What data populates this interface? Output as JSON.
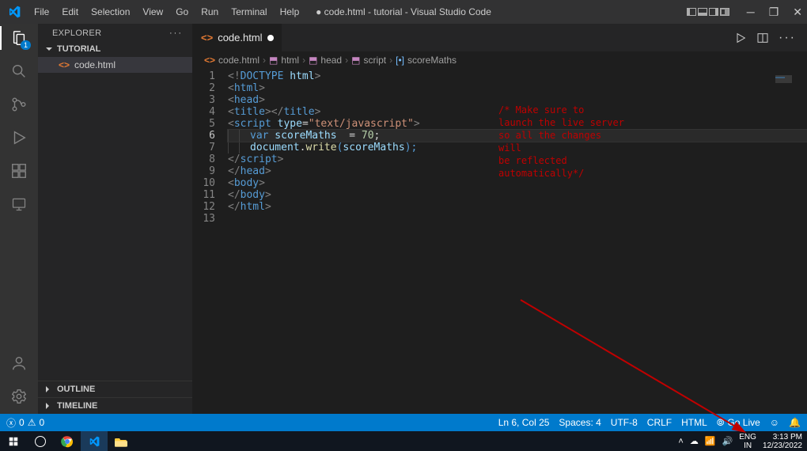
{
  "window": {
    "title": "● code.html - tutorial - Visual Studio Code"
  },
  "menu": [
    "File",
    "Edit",
    "Selection",
    "View",
    "Go",
    "Run",
    "Terminal",
    "Help"
  ],
  "activity": {
    "explorer_badge": "1"
  },
  "sidebar": {
    "title": "EXPLORER",
    "folder": "TUTORIAL",
    "file": "code.html",
    "outline": "OUTLINE",
    "timeline": "TIMELINE"
  },
  "tab": {
    "label": "code.html"
  },
  "breadcrumb": {
    "a": "code.html",
    "b": "html",
    "c": "head",
    "d": "script",
    "e": "scoreMaths"
  },
  "gutter": [
    "1",
    "2",
    "3",
    "4",
    "5",
    "6",
    "7",
    "8",
    "9",
    "10",
    "11",
    "12",
    "13"
  ],
  "code": {
    "l1_a": "<!",
    "l1_b": "DOCTYPE",
    "l1_c": " html",
    "l1_d": ">",
    "l2_a": "<",
    "l2_b": "html",
    "l2_c": ">",
    "l3_a": "<",
    "l3_b": "head",
    "l3_c": ">",
    "l4_a": "<",
    "l4_b": "title",
    "l4_c": "></",
    "l4_d": "title",
    "l4_e": ">",
    "l5_a": "<",
    "l5_b": "script",
    "l5_c": " type",
    "l5_d": "=",
    "l5_e": "\"text/javascript\"",
    "l5_f": ">",
    "l6_a": "var",
    "l6_b": " scoreMaths  ",
    "l6_c": "=",
    "l6_d": " 70",
    "l6_e": ";",
    "l7_a": "document",
    "l7_b": ".",
    "l7_c": "write",
    "l7_d": "(",
    "l7_e": "scoreMaths",
    "l7_f": ");",
    "l8_a": "</",
    "l8_b": "script",
    "l8_c": ">",
    "l9_a": "</",
    "l9_b": "head",
    "l9_c": ">",
    "l10_a": "<",
    "l10_b": "body",
    "l10_c": ">",
    "l11_a": "</",
    "l11_b": "body",
    "l11_c": ">",
    "l12_a": "</",
    "l12_b": "html",
    "l12_c": ">"
  },
  "annotation": {
    "l1": "/* Make sure to",
    "l2": "launch the live server",
    "l3": "so all the changes will",
    "l4": "be reflected",
    "l5": "automatically*/"
  },
  "statusbar": {
    "errors": "0",
    "warnings": "0",
    "lncol": "Ln 6, Col 25",
    "spaces": "Spaces: 4",
    "encoding": "UTF-8",
    "eol": "CRLF",
    "lang": "HTML",
    "golive": "Go Live"
  },
  "taskbar": {
    "lang1": "ENG",
    "lang2": "IN",
    "time": "3:13 PM",
    "date": "12/23/2022"
  }
}
